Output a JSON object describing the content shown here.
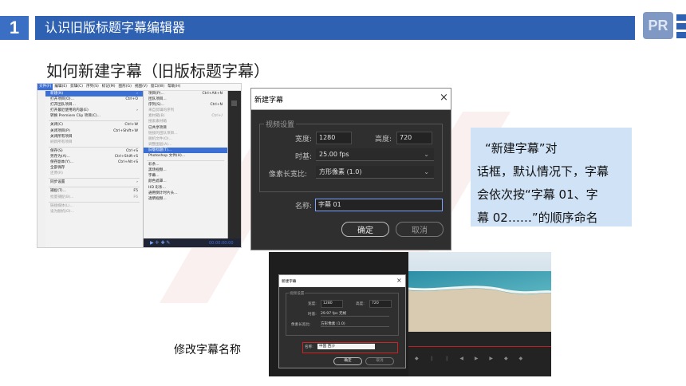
{
  "header": {
    "number": "1",
    "title": "认识旧版标题字幕编辑器",
    "logo": "PR"
  },
  "subtitle": "如何新建字幕（旧版标题字幕）",
  "menu_screenshot": {
    "menubar": [
      "文件(F)",
      "编辑(E)",
      "剪辑(C)",
      "序列(S)",
      "标记(M)",
      "图形(G)",
      "视图(V)",
      "窗口(W)",
      "帮助(H)"
    ],
    "file_menu": [
      {
        "label": "新建(N)",
        "sc": "›",
        "state": "hl"
      },
      {
        "label": "打开项目(O)...",
        "sc": "Ctrl+O"
      },
      {
        "label": "打开团队项目..."
      },
      {
        "label": "打开最近使用的内容(E)",
        "sc": "›"
      },
      {
        "label": "转换 Premiere Clip 项目(C)..."
      },
      {
        "sep": true
      },
      {
        "label": "关闭(C)",
        "sc": "Ctrl+W"
      },
      {
        "label": "关闭项目(P)",
        "sc": "Ctrl+Shift+W"
      },
      {
        "label": "关闭所有项目"
      },
      {
        "label": "刷新所有项目",
        "state": "dis"
      },
      {
        "sep": true
      },
      {
        "label": "保存(S)",
        "sc": "Ctrl+S"
      },
      {
        "label": "另存为(A)...",
        "sc": "Ctrl+Shift+S"
      },
      {
        "label": "保存副本(Y)...",
        "sc": "Ctrl+Alt+S"
      },
      {
        "label": "全部保存"
      },
      {
        "label": "还原(R)",
        "state": "dis"
      },
      {
        "sep": true
      },
      {
        "label": "同步设置",
        "sc": "›"
      },
      {
        "sep": true
      },
      {
        "label": "捕捉(T)...",
        "sc": "F5"
      },
      {
        "label": "批量捕捉(B)...",
        "sc": "F6",
        "state": "dis"
      },
      {
        "sep": true
      },
      {
        "label": "链接媒体(L)...",
        "state": "dis"
      },
      {
        "label": "设为脱机(O)...",
        "state": "dis"
      }
    ],
    "new_submenu": [
      {
        "label": "项目(P)...",
        "sc": "Ctrl+Alt+N"
      },
      {
        "label": "团队项目..."
      },
      {
        "label": "序列(S)...",
        "sc": "Ctrl+N"
      },
      {
        "label": "来自剪辑的序列",
        "state": "dis"
      },
      {
        "label": "素材箱(B)",
        "sc": "Ctrl+/",
        "state": "dis"
      },
      {
        "label": "搜索素材箱",
        "state": "dis"
      },
      {
        "label": "已共享项目"
      },
      {
        "label": "链接的团队项目...",
        "state": "dis"
      },
      {
        "label": "脱机文件(O)...",
        "state": "dis"
      },
      {
        "label": "调整图层(A)...",
        "state": "dis"
      },
      {
        "label": "旧版标题(T)...",
        "state": "hl"
      },
      {
        "label": "Photoshop 文件(H)..."
      },
      {
        "sep": true
      },
      {
        "label": "彩条..."
      },
      {
        "label": "黑场视频..."
      },
      {
        "label": "字幕..."
      },
      {
        "label": "颜色遮罩..."
      },
      {
        "label": "HD 彩条..."
      },
      {
        "label": "通用倒计时片头..."
      },
      {
        "label": "透明视频..."
      }
    ],
    "timecode": "00:00:00:00"
  },
  "dialog1": {
    "title": "新建字幕",
    "close": "×",
    "group": "视频设置",
    "width_label": "宽度:",
    "width_value": "1280",
    "height_label": "高度:",
    "height_value": "720",
    "timebase_label": "时基:",
    "timebase_value": "25.00 fps",
    "par_label": "像素长宽比:",
    "par_value": "方形像素 (1.0)",
    "name_label": "名称:",
    "name_value": "字幕 01",
    "ok": "确定",
    "cancel": "取消"
  },
  "info_box": {
    "line1": "“新建字幕”对",
    "line2": "话框，默认情况下，字幕",
    "line3": "会依次按“字幕 01、字",
    "line4": "幕 02……”的顺序命名"
  },
  "dialog2": {
    "title": "新建字幕",
    "close": "×",
    "group": "视频设置",
    "width_label": "宽度:",
    "width_value": "1280",
    "height_label": "高度:",
    "height_value": "720",
    "timebase_label": "时基:",
    "timebase_value": "29.97 fps 无帧",
    "par_label": "像素长宽比:",
    "par_value": "方形像素 (1.0)",
    "name_label": "名称:",
    "name_value": "中国 西沙",
    "ok": "确定",
    "cancel": "取消"
  },
  "caption2": "修改字幕名称",
  "colors": {
    "header_blue": "#2f61b3",
    "info_bg": "#cfe2f6",
    "highlight_red": "#d32020",
    "menu_highlight": "#3b6fd4"
  }
}
